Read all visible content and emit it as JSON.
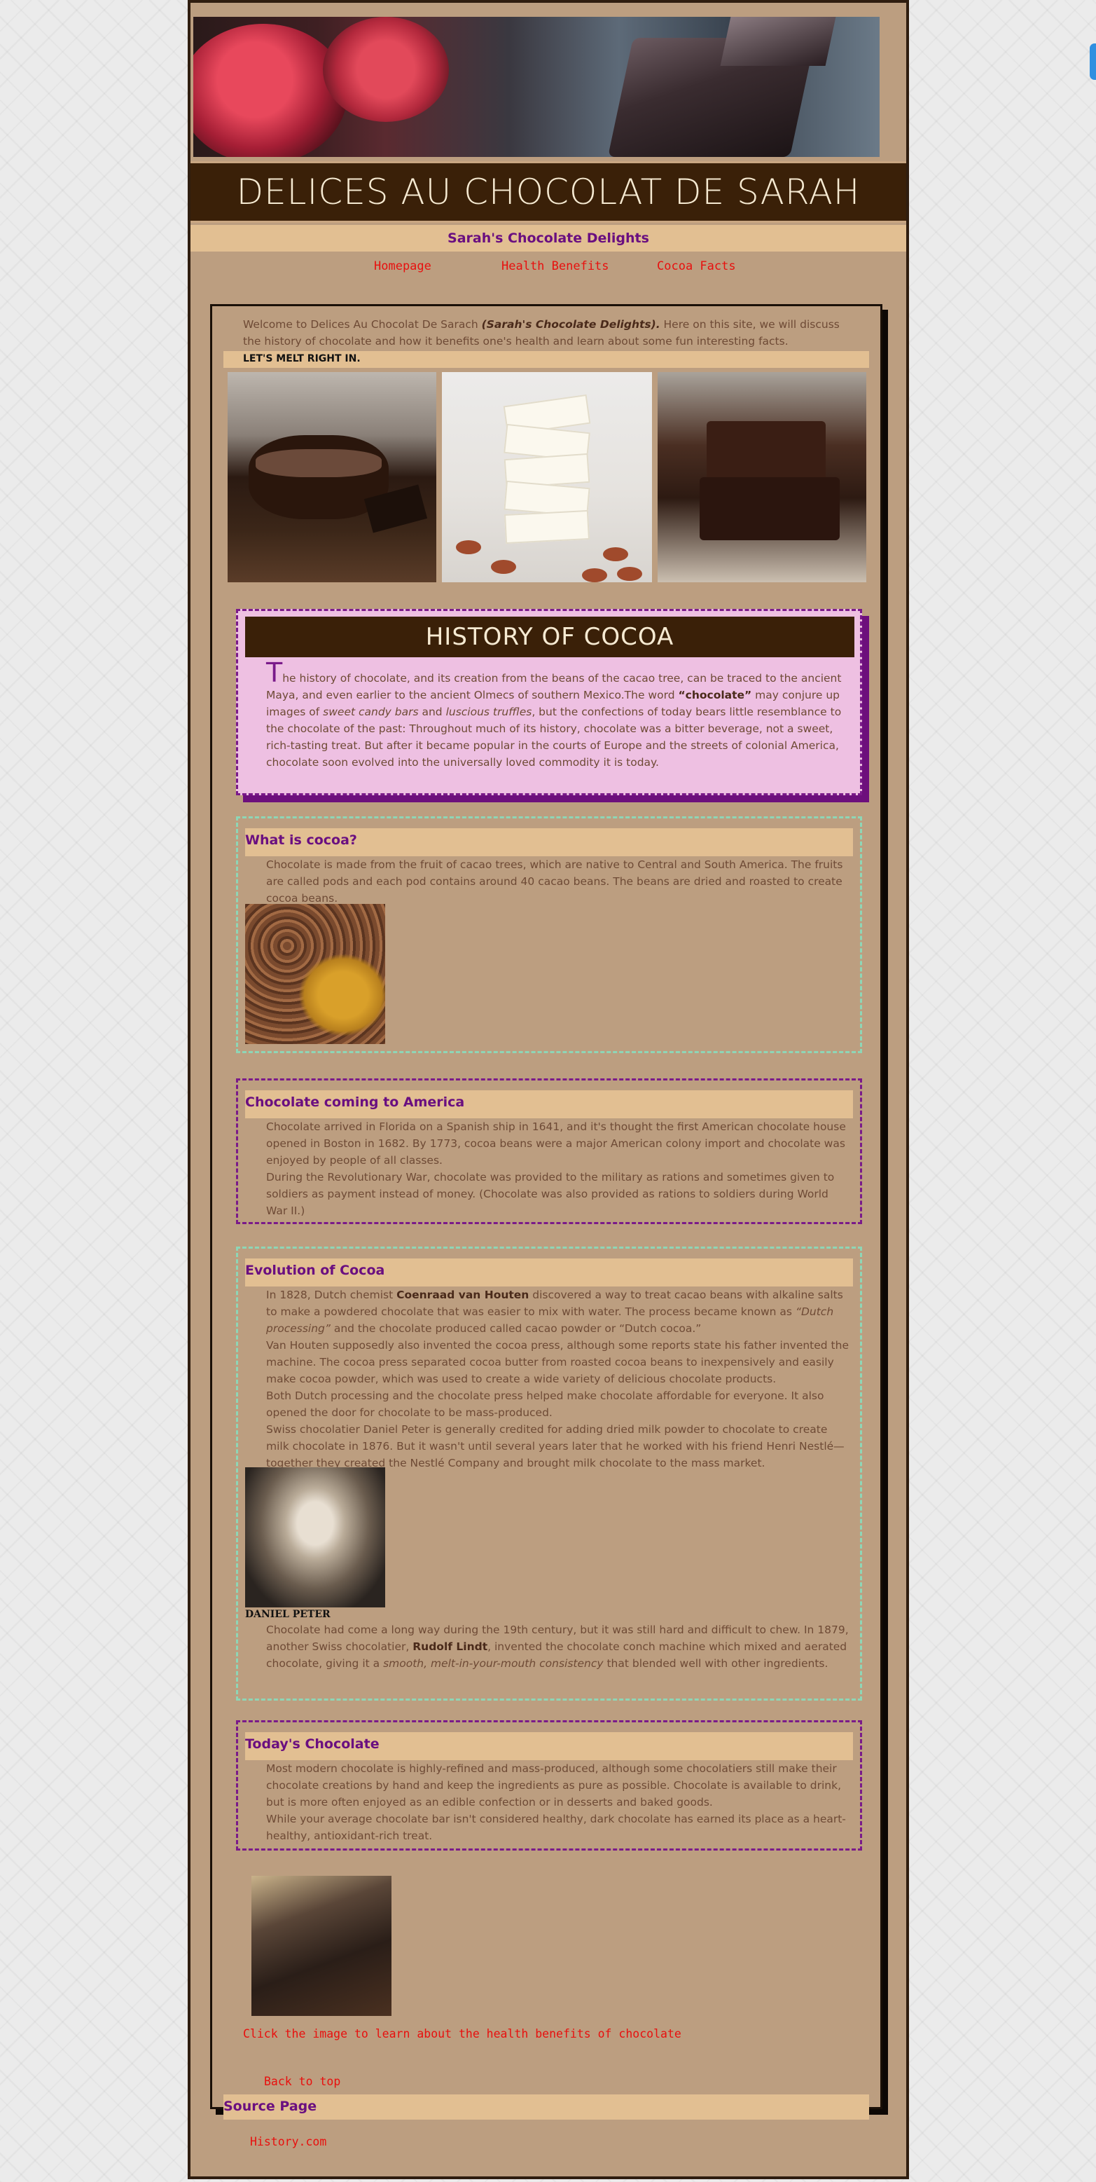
{
  "site": {
    "title": "DELICES AU CHOCOLAT DE SARAH",
    "subtitle": "Sarah's Chocolate Delights"
  },
  "nav": {
    "items": [
      "Homepage",
      "Health Benefits",
      "Cocoa Facts"
    ]
  },
  "intro": {
    "text_a": "Welcome to Delices Au Chocolat De Sarach ",
    "text_b": "(Sarah's Chocolate Delights).",
    "text_c": " Here on this site, we will discuss the history of chocolate and how it benefits one's health and learn about some fun interesting facts."
  },
  "melt": "LET'S MELT RIGHT IN.",
  "history": {
    "title": "HISTORY OF COCOA",
    "dropcap": "T",
    "p1": "he history of chocolate, and its creation from the beans of the cacao tree, can be traced to the ancient Maya, and even earlier to the ancient Olmecs of southern Mexico.The word ",
    "bold": "“chocolate”",
    "p2": " may conjure up images of ",
    "it1": "sweet candy bars",
    "p3": " and ",
    "it2": "luscious truffles",
    "p4": ", but the confections of today bears little resemblance to the chocolate of the past: Throughout much of its history, chocolate was a bitter beverage, not a sweet, rich-tasting treat. But after it became popular in the courts of Europe and the streets of colonial America, chocolate soon evolved into the universally loved commodity it is today."
  },
  "what": {
    "title": "What is cocoa?",
    "text": "Chocolate is made from the fruit of cacao trees, which are native to Central and South America. The fruits are called pods and each pod contains around 40 cacao beans. The beans are dried and roasted to create cocoa beans."
  },
  "america": {
    "title": "Chocolate coming to America",
    "p1": "Chocolate arrived in Florida on a Spanish ship in 1641, and it's thought the first American chocolate house opened in Boston in 1682. By 1773, cocoa beans were a major American colony import and chocolate was enjoyed by people of all classes.",
    "p2": "During the Revolutionary War, chocolate was provided to the military as rations and sometimes given to soldiers as payment instead of money. (Chocolate was also provided as rations to soldiers during World War II.)"
  },
  "evolution": {
    "title": "Evolution of Cocoa",
    "p1a": "In 1828, Dutch chemist ",
    "p1b": "Coenraad van Houten",
    "p1c": " discovered a way to treat cacao beans with alkaline salts to make a powdered chocolate that was easier to mix with water. The process became known as ",
    "p1d": "“Dutch processing”",
    "p1e": " and the chocolate produced called cacao powder or “Dutch cocoa.”",
    "p2": "Van Houten supposedly also invented the cocoa press, although some reports state his father invented the machine. The cocoa press separated cocoa butter from roasted cocoa beans to inexpensively and easily make cocoa powder, which was used to create a wide variety of delicious chocolate products.",
    "p3": "Both Dutch processing and the chocolate press helped make chocolate affordable for everyone. It also opened the door for chocolate to be mass-produced.",
    "p4": "Swiss chocolatier Daniel Peter is generally credited for adding dried milk powder to chocolate to create milk chocolate in 1876. But it wasn't until several years later that he worked with his friend Henri Nestlé—together they created the Nestlé Company and brought milk chocolate to the mass market.",
    "caption": "DANIEL PETER",
    "p5a": "Chocolate had come a long way during the 19th century, but it was still hard and difficult to chew. In 1879, another Swiss chocolatier, ",
    "p5b": "Rudolf Lindt",
    "p5c": ", invented the chocolate conch machine which mixed and aerated chocolate, giving it a ",
    "p5d": "smooth, melt-in-your-mouth consistency",
    "p5e": " that blended well with other ingredients."
  },
  "today": {
    "title": "Today's Chocolate",
    "p1": "Most modern chocolate is highly-refined and mass-produced, although some chocolatiers still make their chocolate creations by hand and keep the ingredients as pure as possible. Chocolate is available to drink, but is more often enjoyed as an edible confection or in desserts and baked goods.",
    "p2": "While your average chocolate bar isn't considered healthy, dark chocolate has earned its place as a heart-healthy, antioxidant-rich treat."
  },
  "links": {
    "health": "Click the image to learn about the health benefits of chocolate",
    "back_top": "Back to top",
    "source_title": "Source Page",
    "source_link": "History.com"
  },
  "colors": {
    "page_bg": "#bc9e80",
    "header_dark": "#3a2008",
    "heading_purple": "#6a0f80",
    "link_red": "#e8100e",
    "band_tan": "#e2bf92"
  }
}
